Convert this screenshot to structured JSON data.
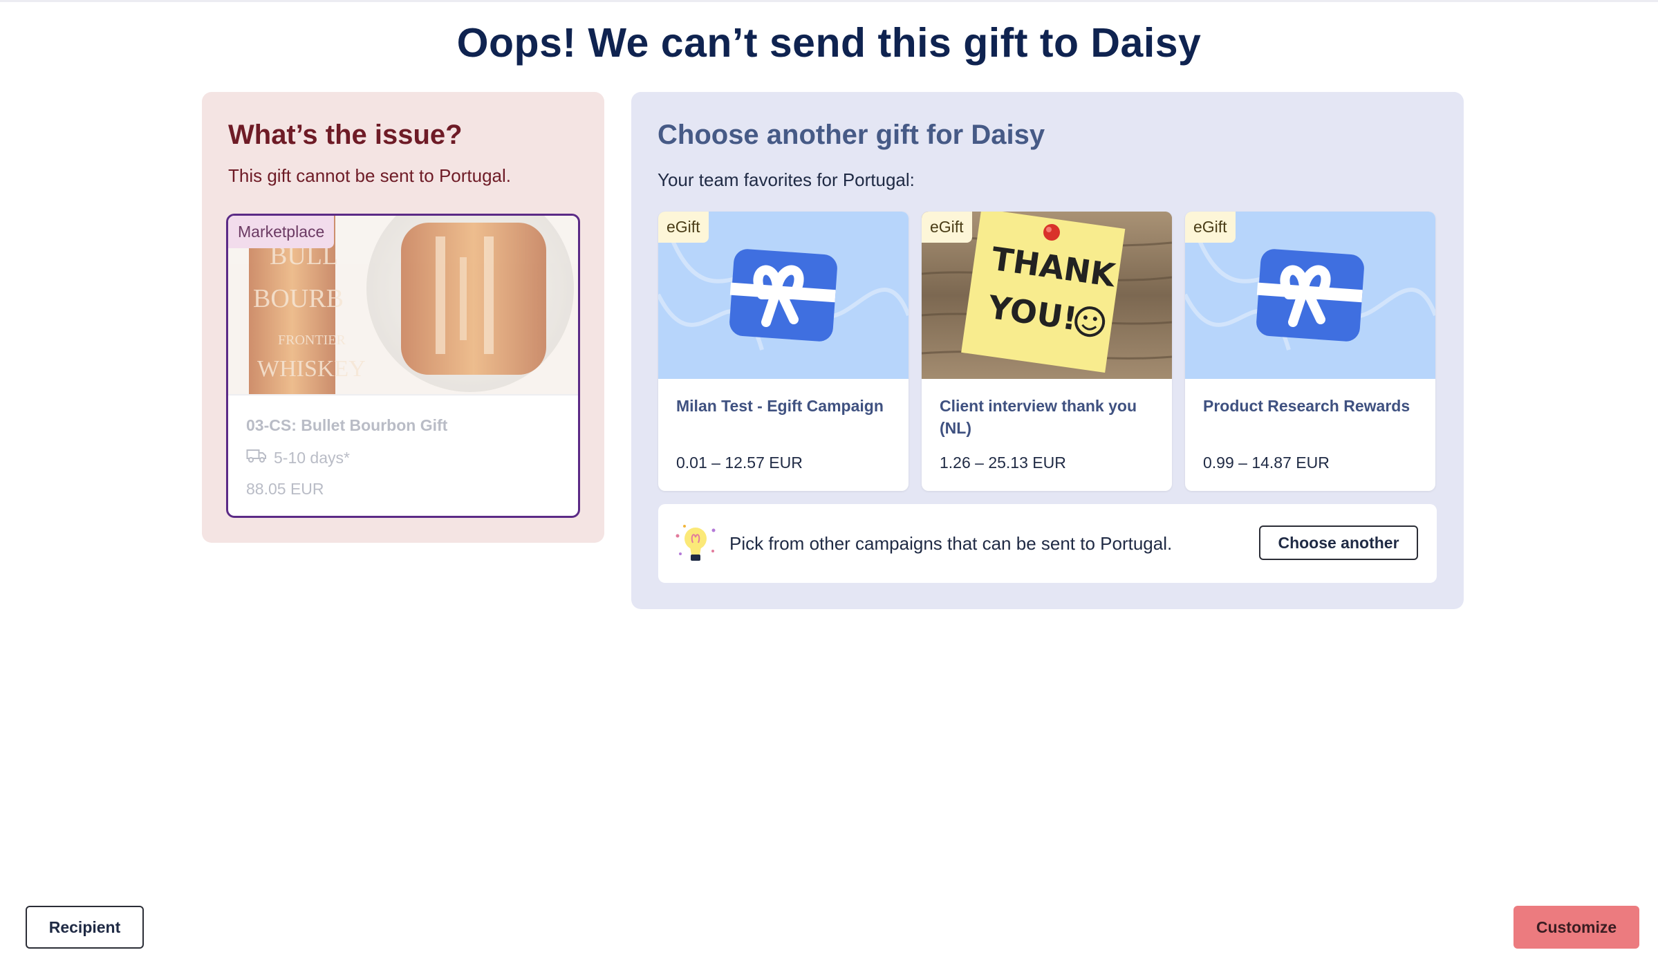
{
  "page": {
    "title": "Oops! We can’t send this gift to Daisy"
  },
  "issue": {
    "heading": "What’s the issue?",
    "message": "This gift cannot be sent to Portugal.",
    "gift": {
      "badge": "Marketplace",
      "name": "03-CS: Bullet Bourbon Gift",
      "delivery": "5-10 days*",
      "price": "88.05 EUR",
      "image_text": [
        "BULL",
        "BOURB",
        "FRONTIER",
        "WHISKEY"
      ]
    }
  },
  "choose": {
    "heading": "Choose another gift for Daisy",
    "subtitle": "Your team favorites for Portugal:",
    "gifts": [
      {
        "badge": "eGift",
        "name": "Milan Test - Egift Campaign",
        "price": "0.01 – 12.57 EUR",
        "image": "gift-card-icon"
      },
      {
        "badge": "eGift",
        "name": "Client interview thank you (NL)",
        "price": "1.26 – 25.13 EUR",
        "image": "thank-you-note",
        "note_line1": "THANK",
        "note_line2": "YOU!"
      },
      {
        "badge": "eGift",
        "name": "Product Research Rewards",
        "price": "0.99 – 14.87 EUR",
        "image": "gift-card-icon"
      }
    ],
    "other": {
      "text": "Pick from other campaigns that can be sent to Portugal.",
      "button": "Choose another"
    }
  },
  "footer": {
    "recipient_label": "Recipient",
    "customize_label": "Customize"
  },
  "colors": {
    "primary": "#0f2350",
    "issue_bg": "#f4e4e3",
    "choose_bg": "#e4e6f4",
    "accent_btn": "#ec7b7f",
    "selected_border": "#5b2a86"
  }
}
